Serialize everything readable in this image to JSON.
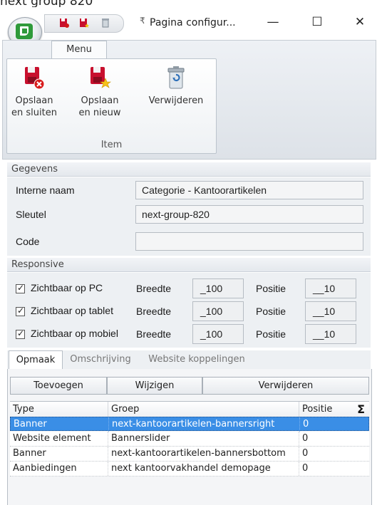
{
  "window": {
    "cut_title": "next group 820",
    "title": "Pagina configur...",
    "qa_separator": "₹",
    "controls": {
      "minimize": "—",
      "maximize": "☐",
      "close": "✕"
    }
  },
  "ribbon": {
    "tab": "Menu",
    "buttons": [
      {
        "line1": "Opslaan",
        "line2": "en sluiten"
      },
      {
        "line1": "Opslaan",
        "line2": "en nieuw"
      },
      {
        "line1": "Verwijderen",
        "line2": ""
      }
    ],
    "group_label": "Item"
  },
  "gegevens": {
    "header": "Gegevens",
    "fields": [
      {
        "label": "Interne naam",
        "value": "Categorie - Kantoorartikelen"
      },
      {
        "label": "Sleutel",
        "value": "next-group-820"
      },
      {
        "label": "Code",
        "value": ""
      }
    ]
  },
  "responsive": {
    "header": "Responsive",
    "rows": [
      {
        "label": "Zichtbaar op PC",
        "width_label": "Breedte",
        "width": "_100",
        "pos_label": "Positie",
        "position": "__10"
      },
      {
        "label": "Zichtbaar op tablet",
        "width_label": "Breedte",
        "width": "_100",
        "pos_label": "Positie",
        "position": "__10"
      },
      {
        "label": "Zichtbaar op mobiel",
        "width_label": "Breedte",
        "width": "_100",
        "pos_label": "Positie",
        "position": "__10"
      }
    ]
  },
  "tabs": [
    "Opmaak",
    "Omschrijving",
    "Website koppelingen"
  ],
  "grid_toolbar": {
    "add": "Toevoegen",
    "edit": "Wijzigen",
    "delete": "Verwijderen"
  },
  "grid": {
    "columns": [
      "Type",
      "Groep",
      "Positie",
      "Σ"
    ],
    "rows": [
      {
        "type": "Banner",
        "group": "next-kantoorartikelen-bannersright",
        "position": "0"
      },
      {
        "type": "Website element",
        "group": "Bannerslider",
        "position": "0"
      },
      {
        "type": "Banner",
        "group": "next-kantoorartikelen-bannersbottom",
        "position": "0"
      },
      {
        "type": "Aanbiedingen",
        "group": "next kantoorvakhandel demopage",
        "position": "0"
      }
    ]
  },
  "colors": {
    "accent": "#3a8ee6",
    "logo_green": "#2f9a3a",
    "save_red": "#c8102e"
  }
}
